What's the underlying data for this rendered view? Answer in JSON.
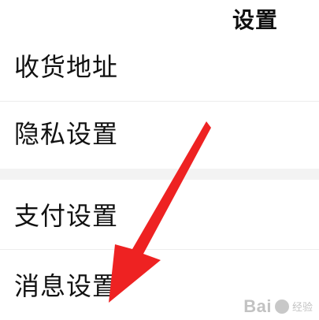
{
  "header": {
    "title": "设置"
  },
  "settings": {
    "items": [
      {
        "label": "收货地址"
      },
      {
        "label": "隐私设置"
      },
      {
        "label": "支付设置"
      },
      {
        "label": "消息设置"
      }
    ]
  },
  "annotation": {
    "arrow_color": "#ee2222",
    "arrow_icon": "red-pointer-arrow-icon"
  },
  "watermark": {
    "brand": "Bai",
    "paw_icon": "baidu-paw-icon",
    "sub": "经验"
  }
}
